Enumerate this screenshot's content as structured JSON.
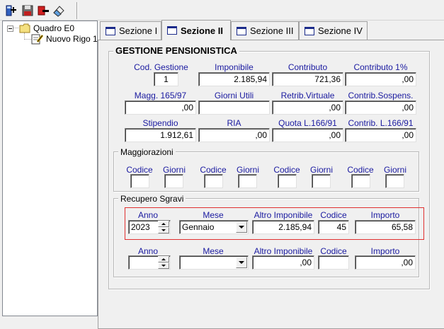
{
  "tree": {
    "root_label": "Quadro E0",
    "child_label": "Nuovo Rigo 1"
  },
  "tabs": [
    {
      "label": "Sezione I"
    },
    {
      "label": "Sezione II"
    },
    {
      "label": "Sezione III"
    },
    {
      "label": "Sezione IV"
    }
  ],
  "gestione": {
    "title": "GESTIONE PENSIONISTICA",
    "cod_gestione": {
      "label": "Cod. Gestione",
      "value": "1"
    },
    "imponibile": {
      "label": "Imponibile",
      "value": "2.185,94"
    },
    "contributo": {
      "label": "Contributo",
      "value": "721,36"
    },
    "contributo_1": {
      "label": "Contributo 1%",
      "value": ",00"
    },
    "magg_165": {
      "label": "Magg. 165/97",
      "value": ",00"
    },
    "giorni_utili": {
      "label": "Giorni Utili",
      "value": ""
    },
    "retrib_virtuale": {
      "label": "Retrib.Virtuale",
      "value": ",00"
    },
    "contrib_sospens": {
      "label": "Contrib.Sospens.",
      "value": ",00"
    },
    "stipendio": {
      "label": "Stipendio",
      "value": "1.912,61"
    },
    "ria": {
      "label": "RIA",
      "value": ",00"
    },
    "quota_166": {
      "label": "Quota L.166/91",
      "value": ",00"
    },
    "contrib_166": {
      "label": "Contrib. L.166/91",
      "value": ",00"
    }
  },
  "maggiorazioni": {
    "title": "Maggiorazioni",
    "codice_label": "Codice",
    "giorni_label": "Giorni"
  },
  "recupero": {
    "title": "Recupero Sgravi",
    "anno_label": "Anno",
    "mese_label": "Mese",
    "altro_label": "Altro Imponibile",
    "codice_label": "Codice",
    "importo_label": "Importo",
    "row1": {
      "anno": "2023",
      "mese": "Gennaio",
      "altro": "2.185,94",
      "codice": "45",
      "importo": "65,58"
    },
    "row2": {
      "anno": "",
      "mese": "",
      "altro": ",00",
      "codice": "",
      "importo": ",00"
    }
  }
}
